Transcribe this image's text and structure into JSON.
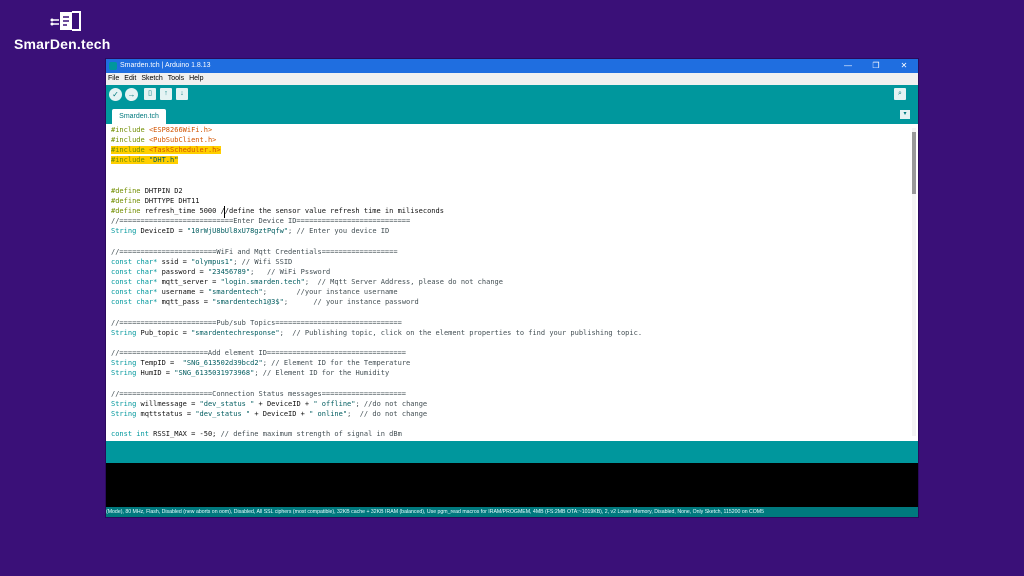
{
  "watermark": {
    "brand": "SmarDen.tech"
  },
  "window": {
    "title": "Smarden.tch | Arduino 1.8.13",
    "controls": {
      "minimize": "—",
      "maximize": "❐",
      "close": "✕"
    }
  },
  "menu": [
    "File",
    "Edit",
    "Sketch",
    "Tools",
    "Help"
  ],
  "toolbar": {
    "verify_glyph": "✓",
    "upload_glyph": "→",
    "new_glyph": "▯",
    "open_glyph": "↑",
    "save_glyph": "↓",
    "serial_glyph": "⌕"
  },
  "tab": {
    "label": "Smarden.tch",
    "menu_glyph": "▾"
  },
  "code_lines": [
    [
      {
        "t": "#include ",
        "c": "kw"
      },
      {
        "t": "<ESP8266WiFi.h>",
        "c": "inc"
      }
    ],
    [
      {
        "t": "#include ",
        "c": "kw"
      },
      {
        "t": "<PubSubClient.h>",
        "c": "inc"
      }
    ],
    [
      {
        "t": "#include ",
        "c": "kw hl"
      },
      {
        "t": "<TaskScheduler.h>",
        "c": "inc hl"
      }
    ],
    [
      {
        "t": "#include ",
        "c": "kw hl"
      },
      {
        "t": "\"DHT.h\"",
        "c": "str hl"
      }
    ],
    [],
    [],
    [
      {
        "t": "#define ",
        "c": "kw"
      },
      {
        "t": "DHTPIN D2",
        "c": ""
      }
    ],
    [
      {
        "t": "#define ",
        "c": "kw"
      },
      {
        "t": "DHTTYPE DHT11",
        "c": ""
      }
    ],
    [
      {
        "t": "#define ",
        "c": "kw"
      },
      {
        "t": "refresh_time 5000 //define the sensor value refresh time in miliseconds",
        "c": ""
      }
    ],
    [
      {
        "t": "//===========================Enter Device ID===========================",
        "c": "cmt"
      }
    ],
    [
      {
        "t": "String ",
        "c": "kw2"
      },
      {
        "t": "DeviceID = ",
        "c": ""
      },
      {
        "t": "\"10rWjU8bUl8xU78gztPqfw\"",
        "c": "str"
      },
      {
        "t": "; // Enter you device ID",
        "c": "cmt"
      }
    ],
    [],
    [
      {
        "t": "//=======================WiFi and Mqtt Credentials==================",
        "c": "cmt"
      }
    ],
    [
      {
        "t": "const char* ",
        "c": "kw2"
      },
      {
        "t": "ssid = ",
        "c": ""
      },
      {
        "t": "\"olympus1\"",
        "c": "str"
      },
      {
        "t": "; // Wifi SSID",
        "c": "cmt"
      }
    ],
    [
      {
        "t": "const char* ",
        "c": "kw2"
      },
      {
        "t": "password = ",
        "c": ""
      },
      {
        "t": "\"23456789\"",
        "c": "str"
      },
      {
        "t": ";   // WiFi Pssword",
        "c": "cmt"
      }
    ],
    [
      {
        "t": "const char* ",
        "c": "kw2"
      },
      {
        "t": "mqtt_server = ",
        "c": ""
      },
      {
        "t": "\"login.smarden.tech\"",
        "c": "str"
      },
      {
        "t": ";  // Mqtt Server Address, please do not change",
        "c": "cmt"
      }
    ],
    [
      {
        "t": "const char* ",
        "c": "kw2"
      },
      {
        "t": "username = ",
        "c": ""
      },
      {
        "t": "\"smardentech\"",
        "c": "str"
      },
      {
        "t": ";       //your instance username",
        "c": "cmt"
      }
    ],
    [
      {
        "t": "const char* ",
        "c": "kw2"
      },
      {
        "t": "mqtt_pass = ",
        "c": ""
      },
      {
        "t": "\"smardentech1@3$\"",
        "c": "str"
      },
      {
        "t": ";      // your instance password",
        "c": "cmt"
      }
    ],
    [],
    [
      {
        "t": "//=======================Pub/sub Topics==============================",
        "c": "cmt"
      }
    ],
    [
      {
        "t": "String ",
        "c": "kw2"
      },
      {
        "t": "Pub_topic = ",
        "c": ""
      },
      {
        "t": "\"smardentechresponse\"",
        "c": "str"
      },
      {
        "t": ";  // Publishing topic, click on the element properties to find your publishing topic.",
        "c": "cmt"
      }
    ],
    [],
    [
      {
        "t": "//=====================Add element ID=================================",
        "c": "cmt"
      }
    ],
    [
      {
        "t": "String ",
        "c": "kw2"
      },
      {
        "t": "TempID =  ",
        "c": ""
      },
      {
        "t": "\"SNG_613502d39bcd2\"",
        "c": "str"
      },
      {
        "t": "; // Element ID for the Temperature",
        "c": "cmt"
      }
    ],
    [
      {
        "t": "String ",
        "c": "kw2"
      },
      {
        "t": "HumID = ",
        "c": ""
      },
      {
        "t": "\"SNG_6135031973968\"",
        "c": "str"
      },
      {
        "t": "; // Element ID for the Humidity",
        "c": "cmt"
      }
    ],
    [],
    [
      {
        "t": "//======================Connection Status messages====================",
        "c": "cmt"
      }
    ],
    [
      {
        "t": "String ",
        "c": "kw2"
      },
      {
        "t": "willmessage = ",
        "c": ""
      },
      {
        "t": "\"dev_status \"",
        "c": "str"
      },
      {
        "t": " + DeviceID + ",
        "c": ""
      },
      {
        "t": "\" offline\"",
        "c": "str"
      },
      {
        "t": "; //do not change",
        "c": "cmt"
      }
    ],
    [
      {
        "t": "String ",
        "c": "kw2"
      },
      {
        "t": "mqttstatus = ",
        "c": ""
      },
      {
        "t": "\"dev_status \"",
        "c": "str"
      },
      {
        "t": " + DeviceID + ",
        "c": ""
      },
      {
        "t": "\" online\"",
        "c": "str"
      },
      {
        "t": ";  // do not change",
        "c": "cmt"
      }
    ],
    [],
    [
      {
        "t": "const int ",
        "c": "kw2"
      },
      {
        "t": "RSSI_MAX = -50; ",
        "c": ""
      },
      {
        "t": "// define maximum strength of signal in dBm",
        "c": "cmt"
      }
    ]
  ],
  "statusbar": {
    "text": "(Mode), 80 MHz, Flash, Disabled (new aborts on oom), Disabled, All SSL ciphers (most compatible), 32KB cache + 32KB IRAM (balanced), Use pgm_read macros for IRAM/PROGMEM, 4MB (FS:2MB OTA:~1019KB), 2, v2 Lower Memory, Disabled, None, Only Sketch, 115200 on COM5"
  },
  "colors": {
    "accent": "#00979d",
    "background": "#3a1078",
    "titlebar": "#1f6ee0",
    "highlight": "#ffcf00"
  }
}
